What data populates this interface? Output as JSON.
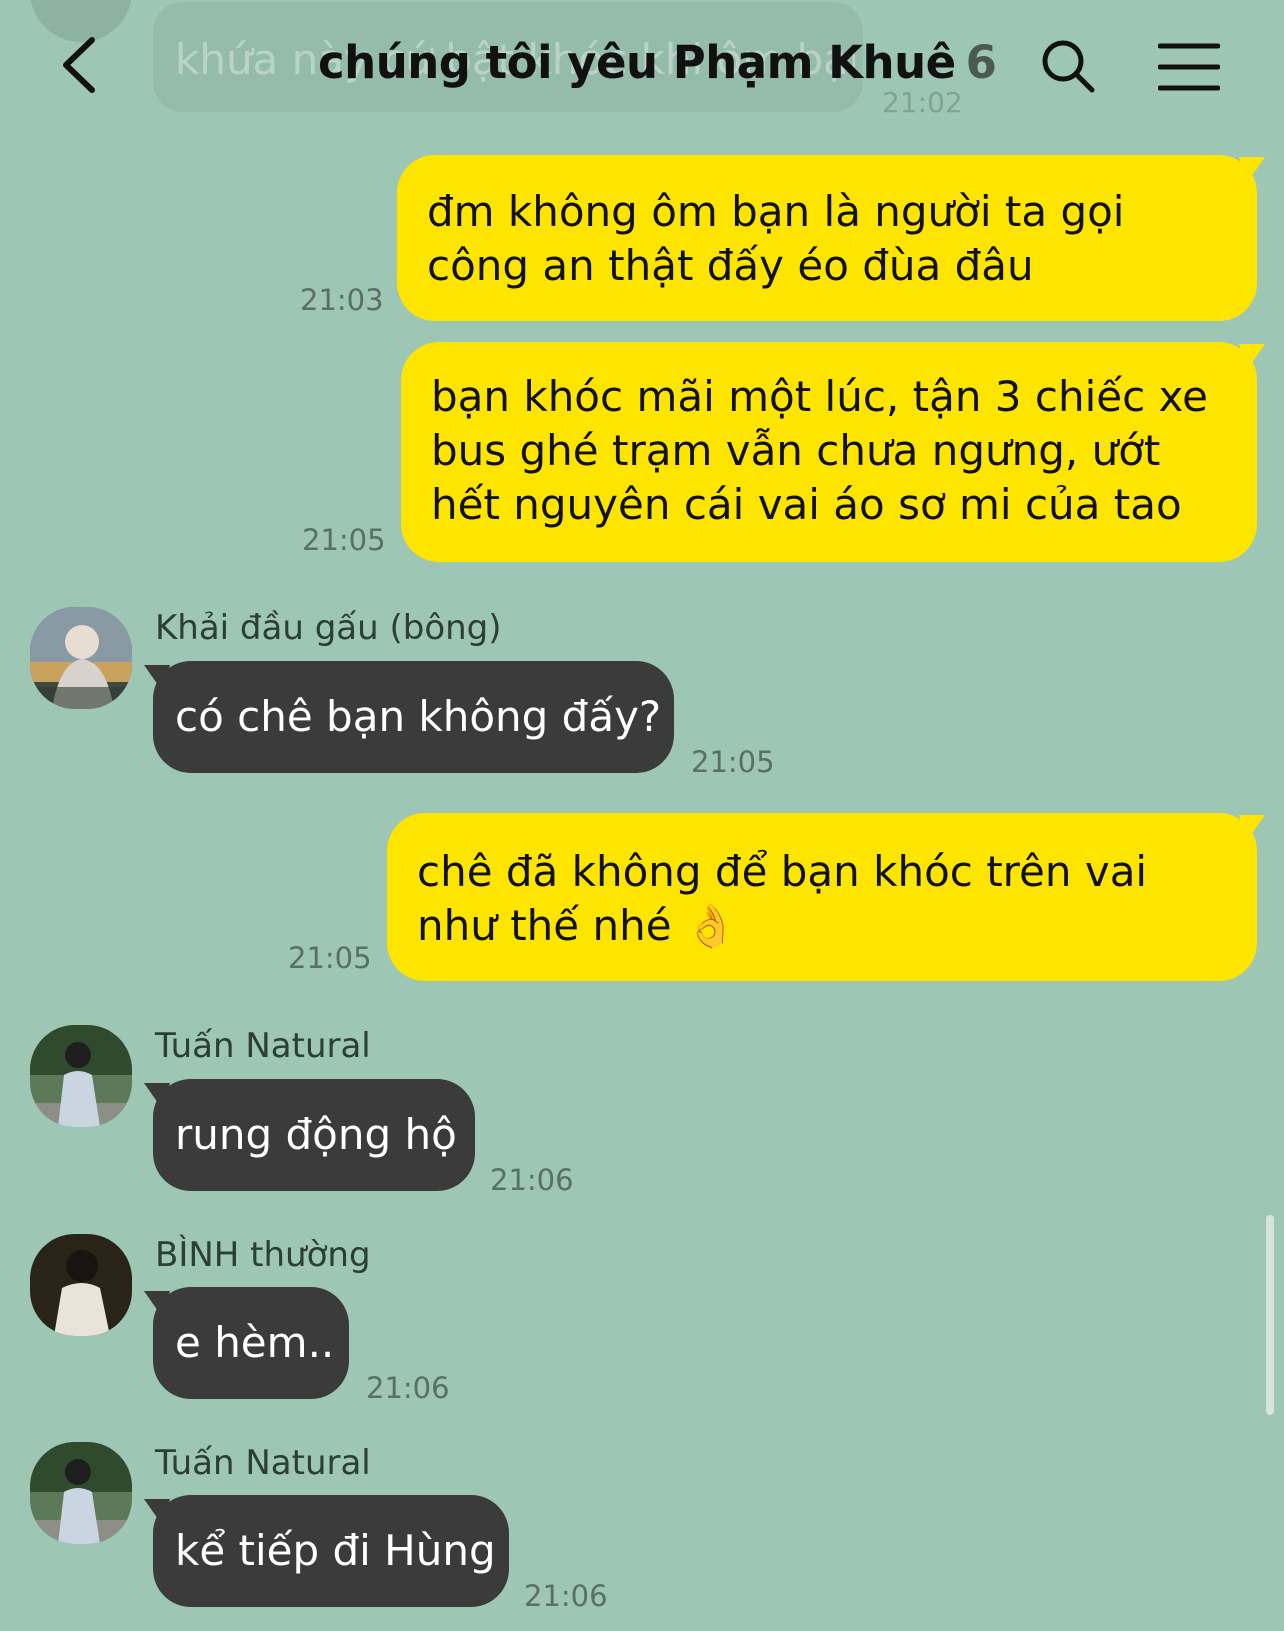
{
  "header": {
    "title": "chúng tôi yêu Phạm Khuê",
    "member_count": "6"
  },
  "ghost": {
    "text": "khứa này cứ bật khóc khi ôm bạn đó",
    "time": "21:02"
  },
  "messages": [
    {
      "side": "out",
      "text": "đm không ôm bạn là người ta gọi công an thật đấy éo đùa đâu",
      "time": "21:03"
    },
    {
      "side": "out",
      "text": "bạn khóc mãi một lúc, tận 3 chiếc xe bus ghé trạm vẫn chưa ngưng, ướt hết nguyên cái vai áo sơ mi của tao",
      "time": "21:05"
    },
    {
      "side": "in",
      "sender": "Khải đầu gấu (bông)",
      "text": "có chê bạn không đấy?",
      "time": "21:05"
    },
    {
      "side": "out",
      "text": "chê đã không để bạn khóc trên vai như thế nhé 👌",
      "time": "21:05"
    },
    {
      "side": "in",
      "sender": "Tuấn Natural",
      "text": "rung động hộ",
      "time": "21:06"
    },
    {
      "side": "in",
      "sender": "BÌNH thường",
      "text": "e hèm..",
      "time": "21:06"
    },
    {
      "side": "in",
      "sender": "Tuấn Natural",
      "text": "kể tiếp đi Hùng",
      "time": "21:06"
    }
  ],
  "colors": {
    "background": "#9dc6b4",
    "outgoing_bubble": "#fee500",
    "incoming_bubble": "#3b3b3b"
  },
  "icons": {
    "back": "chevron-left-icon",
    "search": "search-icon",
    "menu": "hamburger-menu-icon"
  }
}
